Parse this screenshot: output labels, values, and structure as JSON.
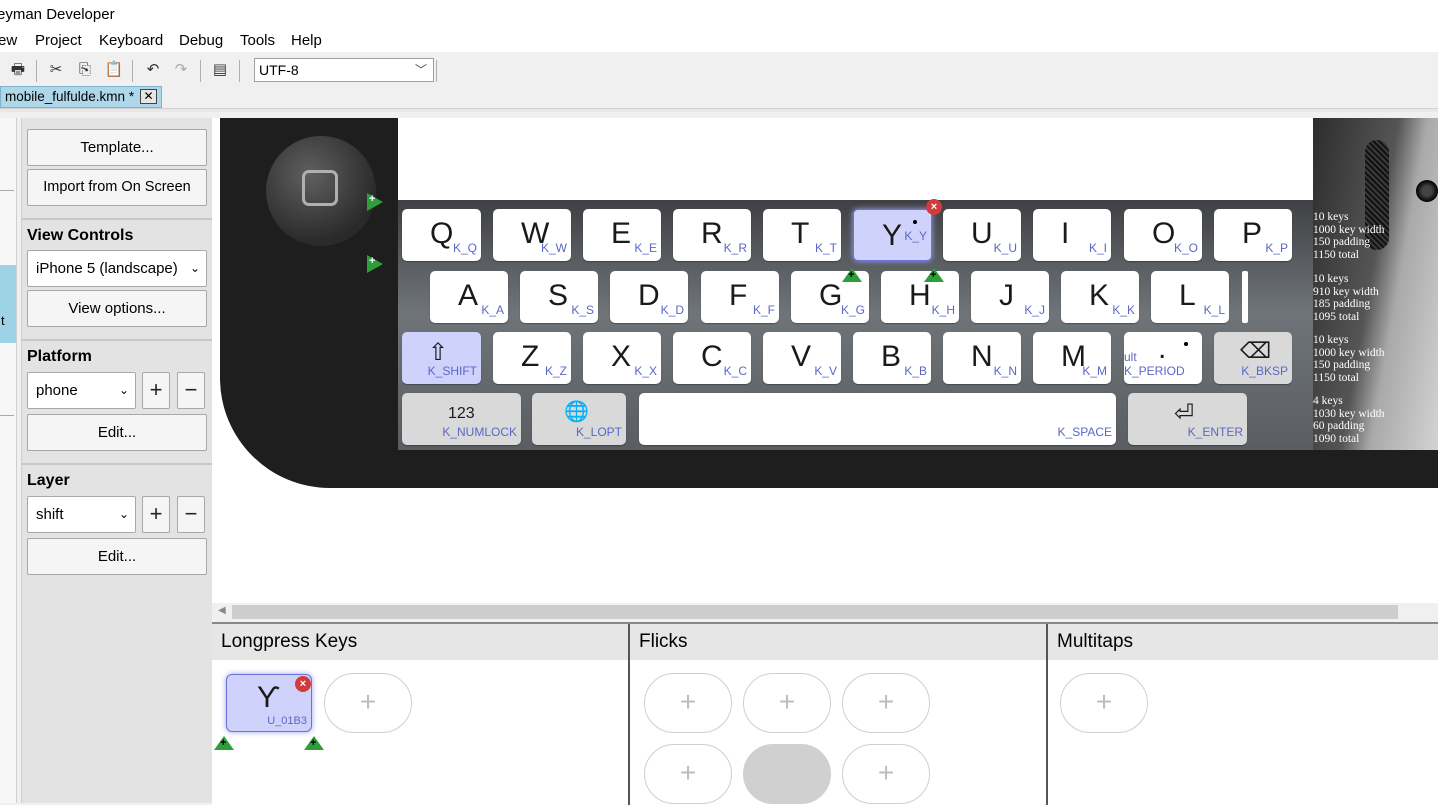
{
  "window": {
    "title": "eyman Developer"
  },
  "menu": {
    "items": [
      "ew",
      "Project",
      "Keyboard",
      "Debug",
      "Tools",
      "Help"
    ]
  },
  "toolbar": {
    "icons": [
      "print-icon",
      "cut-icon",
      "copy-icon",
      "paste-icon",
      "undo-icon",
      "redo-icon",
      "font-icon"
    ],
    "encoding": "UTF-8"
  },
  "tab": {
    "label": "mobile_fulfulde.kmn *"
  },
  "left_strip": {
    "selected_char": "t"
  },
  "panel": {
    "template_button": "Template...",
    "import_button": "Import from On Screen",
    "view_controls": {
      "heading": "View Controls",
      "device": "iPhone 5 (landscape)",
      "view_options_button": "View options..."
    },
    "platform": {
      "heading": "Platform",
      "value": "phone",
      "edit_button": "Edit..."
    },
    "layer": {
      "heading": "Layer",
      "value": "shift",
      "edit_button": "Edit..."
    }
  },
  "keyboard": {
    "rows": [
      {
        "keys": [
          {
            "cap": "Q",
            "id": "K_Q"
          },
          {
            "cap": "W",
            "id": "K_W"
          },
          {
            "cap": "E",
            "id": "K_E"
          },
          {
            "cap": "R",
            "id": "K_R"
          },
          {
            "cap": "T",
            "id": "K_T"
          },
          {
            "cap": "Y",
            "id": "K_Y",
            "selected": true
          },
          {
            "cap": "U",
            "id": "K_U"
          },
          {
            "cap": "I",
            "id": "K_I"
          },
          {
            "cap": "O",
            "id": "K_O"
          },
          {
            "cap": "P",
            "id": "K_P"
          }
        ],
        "info": [
          "10 keys",
          "1000 key width",
          "150 padding",
          "1150 total"
        ]
      },
      {
        "keys": [
          {
            "cap": "A",
            "id": "K_A"
          },
          {
            "cap": "S",
            "id": "K_S"
          },
          {
            "cap": "D",
            "id": "K_D"
          },
          {
            "cap": "F",
            "id": "K_F"
          },
          {
            "cap": "G",
            "id": "K_G"
          },
          {
            "cap": "H",
            "id": "K_H"
          },
          {
            "cap": "J",
            "id": "K_J"
          },
          {
            "cap": "K",
            "id": "K_K"
          },
          {
            "cap": "L",
            "id": "K_L"
          }
        ],
        "info": [
          "10 keys",
          "910 key width",
          "185 padding",
          "1095 total"
        ]
      },
      {
        "keys": [
          {
            "cap": "⇧",
            "id": "K_SHIFT"
          },
          {
            "cap": "Z",
            "id": "K_Z"
          },
          {
            "cap": "X",
            "id": "K_X"
          },
          {
            "cap": "C",
            "id": "K_C"
          },
          {
            "cap": "V",
            "id": "K_V"
          },
          {
            "cap": "B",
            "id": "K_B"
          },
          {
            "cap": "N",
            "id": "K_N"
          },
          {
            "cap": "M",
            "id": "K_M"
          },
          {
            "cap": ".",
            "id": "ult K_PERIOD"
          },
          {
            "cap": "⌫",
            "id": "K_BKSP"
          }
        ],
        "info": [
          "10 keys",
          "1000 key width",
          "150 padding",
          "1150 total"
        ]
      },
      {
        "keys": [
          {
            "cap": "123",
            "id": "K_NUMLOCK"
          },
          {
            "cap": "🌐",
            "id": "K_LOPT"
          },
          {
            "cap": "",
            "id": "K_SPACE"
          },
          {
            "cap": "⏎",
            "id": "K_ENTER"
          }
        ],
        "info": [
          "4 keys",
          "1030 key width",
          "60 padding",
          "1090 total"
        ]
      }
    ]
  },
  "bottom": {
    "longpress": {
      "heading": "Longpress Keys",
      "key_cap": "Ƴ",
      "key_id": "U_01B3",
      "add": "+"
    },
    "flicks": {
      "heading": "Flicks",
      "add": "+"
    },
    "multitaps": {
      "heading": "Multitaps",
      "add": "+"
    }
  },
  "colors": {
    "accent": "#aed8ea",
    "selected_key": "#cfd2fb",
    "key_id": "#5b67c7"
  }
}
